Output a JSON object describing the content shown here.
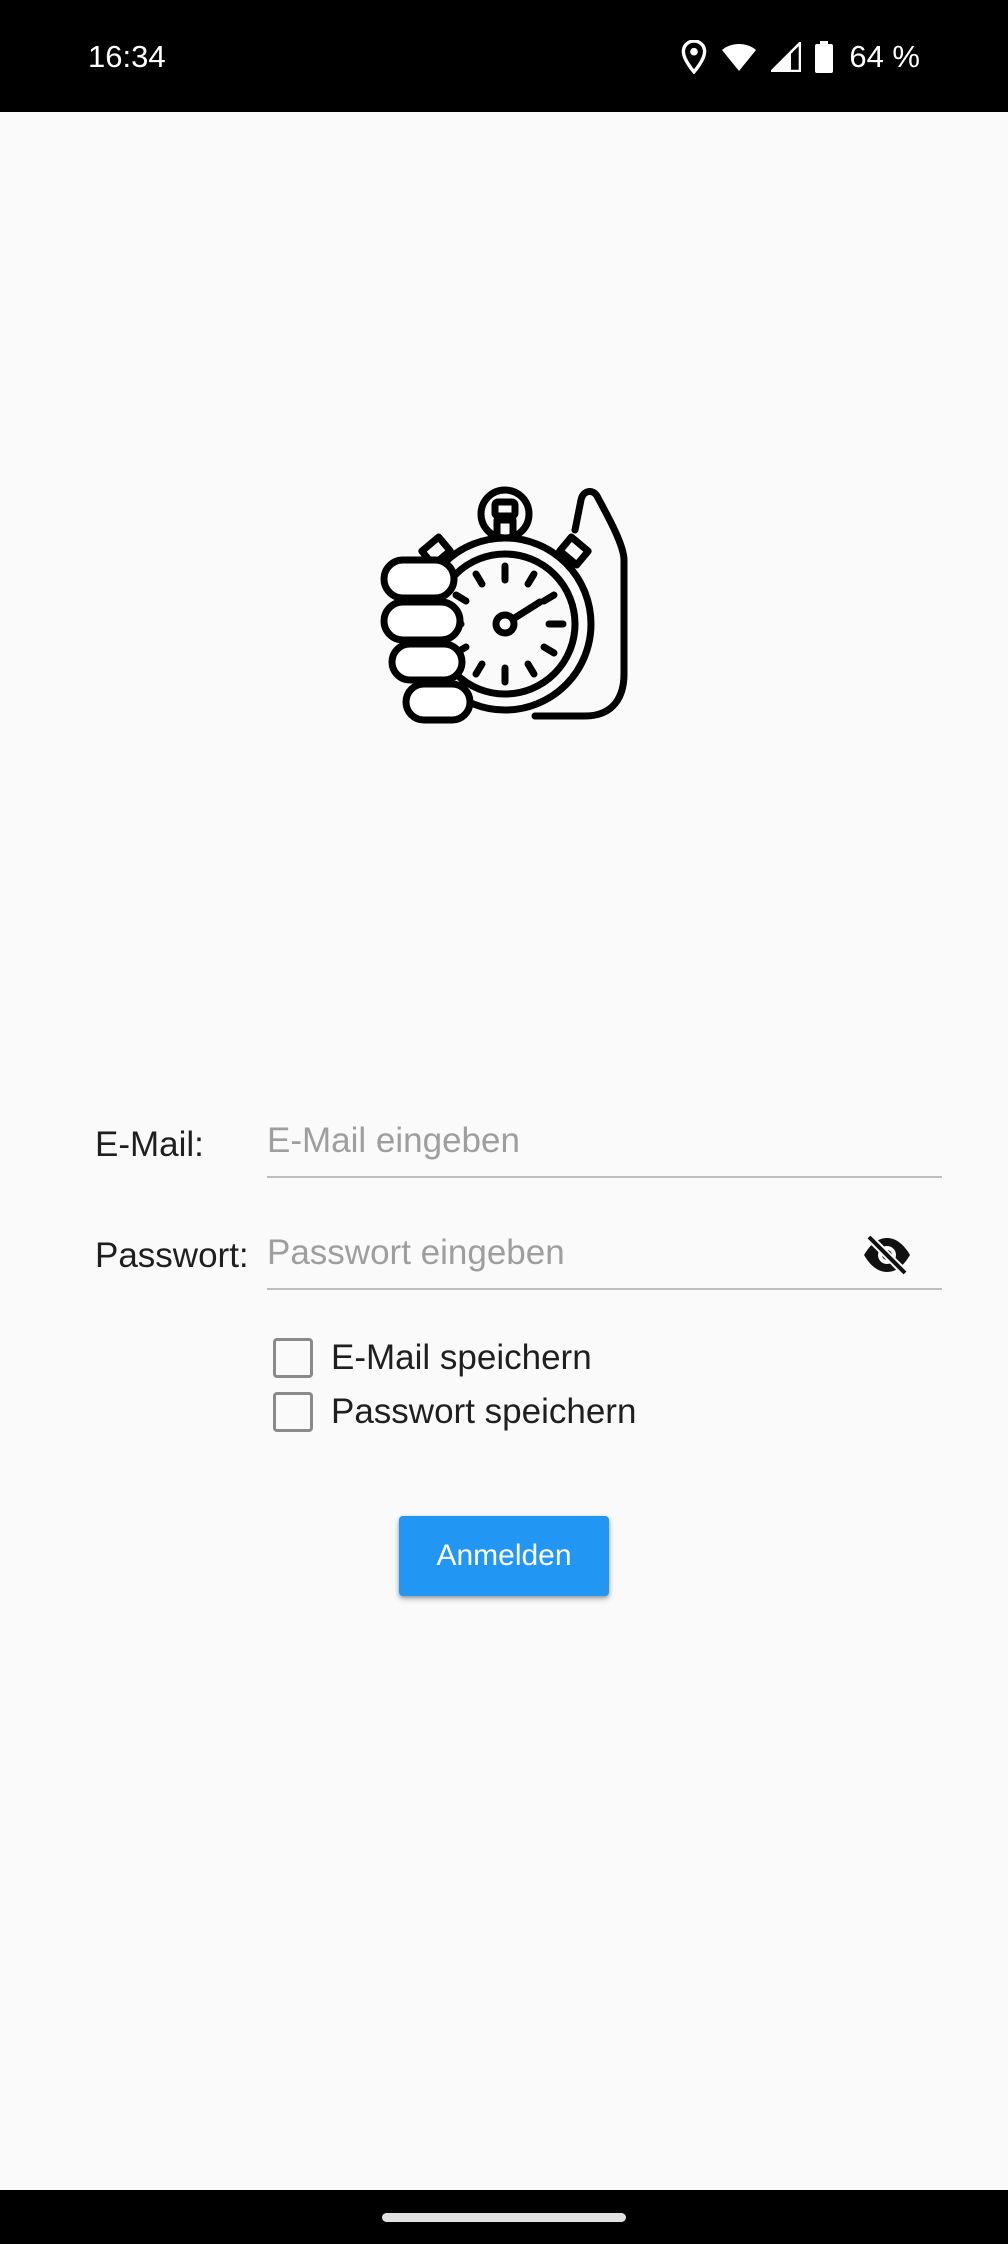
{
  "status_bar": {
    "time": "16:34",
    "battery": "64 %",
    "icons": [
      "location-icon",
      "wifi-icon",
      "signal-icon",
      "battery-icon"
    ]
  },
  "logo": {
    "icon": "hand-stopwatch-icon"
  },
  "form": {
    "email_label": "E-Mail:",
    "email_placeholder": "E-Mail eingeben",
    "email_value": "",
    "password_label": "Passwort:",
    "password_placeholder": "Passwort eingeben",
    "password_value": "",
    "password_toggle_icon": "eye-off-icon",
    "save_email_label": "E-Mail speichern",
    "save_email_checked": false,
    "save_password_label": "Passwort speichern",
    "save_password_checked": false,
    "login_button": "Anmelden"
  },
  "colors": {
    "accent": "#2196f3",
    "background": "#fafafa",
    "system_bars": "#000000"
  }
}
